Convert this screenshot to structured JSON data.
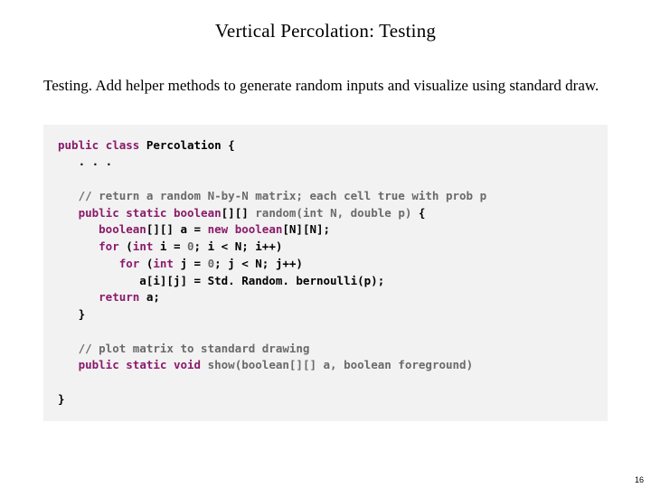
{
  "title": "Vertical Percolation:  Testing",
  "para": {
    "lead": "Testing.",
    "rest": "  Add helper methods to generate random inputs and visualize using standard draw."
  },
  "code": {
    "l01_a": "public",
    "l01_b": " ",
    "l01_c": "class",
    "l01_d": " Percolation {",
    "l02": "   . . .",
    "l03": "   ",
    "l03_c": "// return a random N-by-N matrix; each cell true with prob p",
    "l04_a": "   ",
    "l04_b": "public",
    "l04_c": " ",
    "l04_d": "static",
    "l04_e": " ",
    "l04_f": "boolean",
    "l04_g": "[][] ",
    "l04_h": "random(int N, double p)",
    "l04_i": " {",
    "l05_a": "      ",
    "l05_b": "boolean",
    "l05_c": "[][] a = ",
    "l05_d": "new",
    "l05_e": " ",
    "l05_f": "boolean",
    "l05_g": "[N][N];",
    "l06_a": "      ",
    "l06_b": "for",
    "l06_c": " (",
    "l06_d": "int",
    "l06_e": " i = ",
    "l06_f": "0",
    "l06_g": "; i < N; i++)",
    "l07_a": "         ",
    "l07_b": "for",
    "l07_c": " (",
    "l07_d": "int",
    "l07_e": " j = ",
    "l07_f": "0",
    "l07_g": "; j < N; j++)",
    "l08": "            a[i][j] = Std. Random. bernoulli(p);",
    "l09_a": "      ",
    "l09_b": "return",
    "l09_c": " a;",
    "l10": "   }",
    "l11": "   ",
    "l11_c": "// plot matrix to standard drawing",
    "l12_a": "   ",
    "l12_b": "public",
    "l12_c": " ",
    "l12_d": "static",
    "l12_e": " ",
    "l12_f": "void",
    "l12_g": " ",
    "l12_h": "show(boolean[][] a, boolean foreground)",
    "l13": "}"
  },
  "page_number": "16"
}
